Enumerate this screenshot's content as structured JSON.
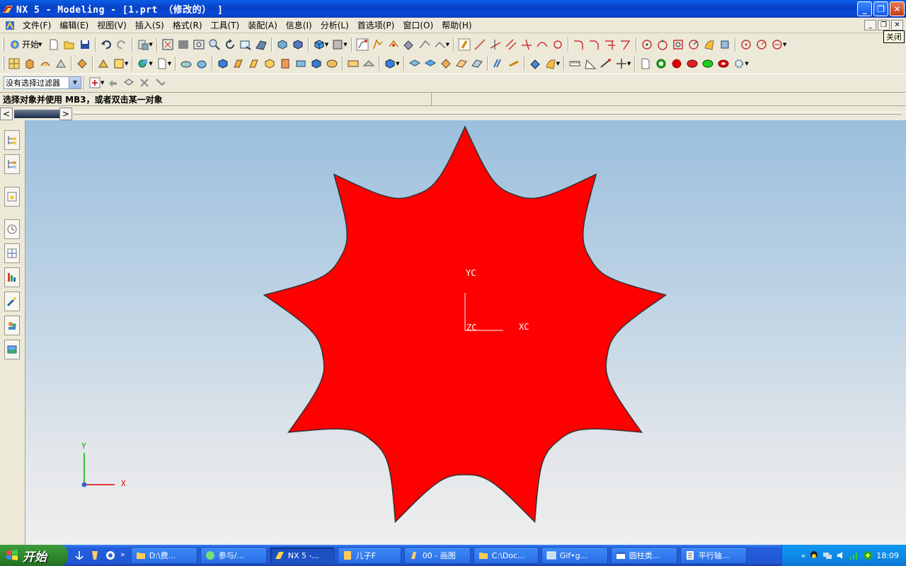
{
  "window": {
    "title": "NX 5 - Modeling - [1.prt （修改的） ]",
    "controls": [
      "minimize",
      "maximize",
      "close"
    ]
  },
  "menu": {
    "items": [
      "文件(F)",
      "编辑(E)",
      "视图(V)",
      "插入(S)",
      "格式(R)",
      "工具(T)",
      "装配(A)",
      "信息(I)",
      "分析(L)",
      "首选项(P)",
      "窗口(O)",
      "帮助(H)"
    ],
    "close_tooltip": "关闭"
  },
  "toolbar": {
    "start_label": "开始"
  },
  "selection": {
    "filter_value": "没有选择过滤器"
  },
  "cue": {
    "text": "选择对象并使用 MB3，或者双击某一对象"
  },
  "viewport": {
    "wcs": {
      "yc": "YC",
      "xc": "XC",
      "zc": "ZC"
    },
    "triad": {
      "y": "Y",
      "x": "X"
    },
    "model_color": "#ff0000",
    "teeth_count": 9
  },
  "taskbar": {
    "start_label": "开始",
    "tasks": [
      "D:\\费...",
      "参与/...",
      "NX 5 -...",
      "儿子F",
      "00 - 画图",
      "C:\\Doc...",
      "Gif•g...",
      "圆柱类...",
      "平行轴..."
    ],
    "active_task": "NX 5 -...",
    "clock": "18:09"
  }
}
